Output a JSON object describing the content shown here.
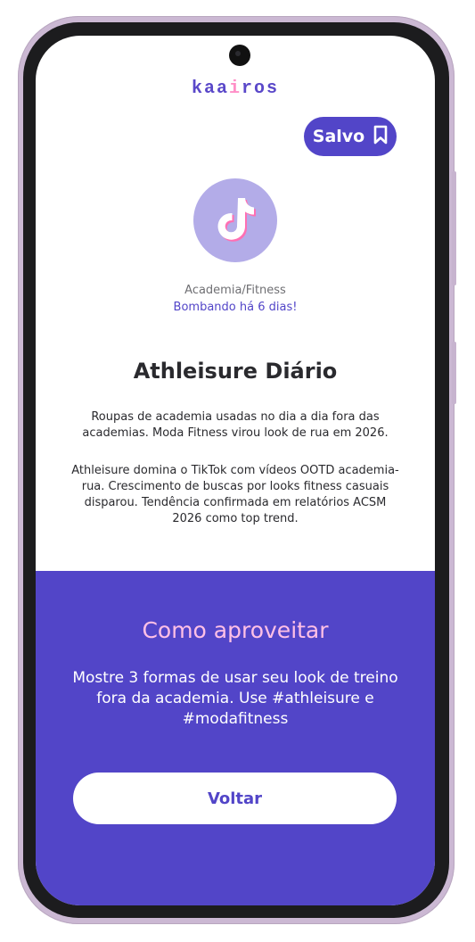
{
  "app": {
    "brand_part1": "kaa",
    "brand_part2": "i",
    "brand_part3": "ros"
  },
  "header": {
    "saved_label": "Salvo",
    "saved_icon": "bookmark-icon"
  },
  "trend": {
    "icon": "tiktok-logo",
    "category": "Academia/Fitness",
    "trending_status": "Bombando há 6 dias!",
    "title": "Athleisure Diário",
    "description": "Roupas de academia usadas no dia a dia fora das academias. Moda Fitness virou look de rua em 2026.",
    "details": "Athleisure domina o TikTok com vídeos OOTD academia-rua. Crescimento de buscas por looks fitness casuais disparou. Tendência confirmada em relatórios ACSM 2026 como top trend."
  },
  "how_to": {
    "title": "Como aproveitar",
    "text": "Mostre 3 formas de usar seu look de treino fora da academia. Use #athleisure e #modafitness"
  },
  "actions": {
    "back_label": "Voltar"
  },
  "colors": {
    "accent": "#5245c8",
    "pink": "#ffc0e6",
    "avatar_bg": "#b3ace8"
  }
}
